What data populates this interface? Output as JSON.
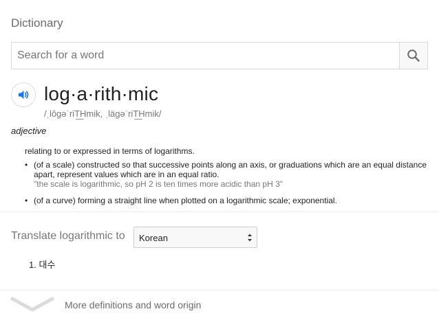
{
  "header": {
    "title": "Dictionary"
  },
  "search": {
    "placeholder": "Search for a word",
    "value": ""
  },
  "entry": {
    "headword": "log·a·rith·mic",
    "phonetic": "/ˌlôɡəˈriT͟Hmik, ˌläɡəˈriT͟Hmik/",
    "part_of_speech": "adjective",
    "main_definition": "relating to or expressed in terms of logarithms.",
    "senses": [
      {
        "text": "(of a scale) constructed so that successive points along an axis, or graduations which are an equal distance apart, represent values which are in an equal ratio.",
        "example": "\"the scale is logarithmic, so pH 2 is ten times more acidic than pH 3\""
      },
      {
        "text": "(of a curve) forming a straight line when plotted on a logarithmic scale; exponential.",
        "example": ""
      }
    ]
  },
  "translate": {
    "label": "Translate logarithmic to",
    "selected_language": "Korean",
    "results": [
      "1. 대수"
    ]
  },
  "footer": {
    "more_label": "More definitions and word origin"
  },
  "icons": {
    "search": "search-icon",
    "speaker": "speaker-icon",
    "select": "up-down-arrows-icon",
    "more": "chevron-down-icon"
  },
  "colors": {
    "accent": "#1a73e8",
    "muted_text": "#777777",
    "border": "#d9d9d9"
  }
}
